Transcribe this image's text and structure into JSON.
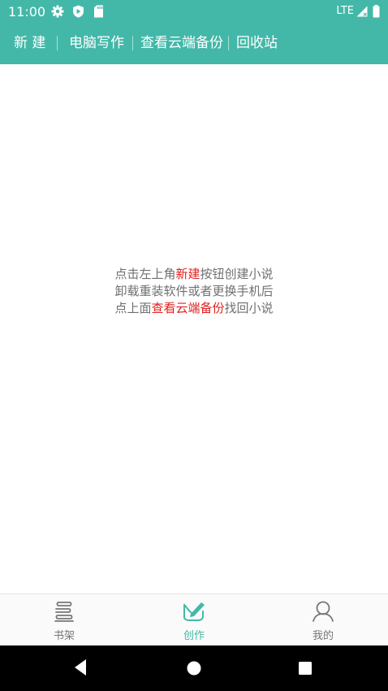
{
  "status_bar": {
    "time": "11:00",
    "network": "LTE",
    "icons": [
      "gear-icon",
      "play-protect-icon",
      "sd-card-icon",
      "signal-icon",
      "battery-icon"
    ]
  },
  "toolbar": {
    "items": [
      {
        "label": "新 建"
      },
      {
        "label": "电脑写作"
      },
      {
        "label": "查看云端备份"
      },
      {
        "label": "回收站"
      }
    ]
  },
  "hint": {
    "line1": {
      "pre": "点击左上角",
      "highlight": "新建",
      "post": "按钮创建小说"
    },
    "line2": "卸载重装软件或者更换手机后",
    "line3": {
      "pre": "点上面",
      "highlight": "查看云端备份",
      "post": "找回小说"
    }
  },
  "tab_bar": {
    "tabs": [
      {
        "label": "书架",
        "icon": "bookshelf-icon",
        "active": false
      },
      {
        "label": "创作",
        "icon": "write-icon",
        "active": true
      },
      {
        "label": "我的",
        "icon": "profile-icon",
        "active": false
      }
    ]
  },
  "nav_bar": {
    "icons": [
      "back-icon",
      "home-icon",
      "recents-icon"
    ]
  },
  "colors": {
    "accent": "#43b8a8",
    "highlight": "#e0201e",
    "hint_text": "#707070",
    "tab_inactive": "#777777"
  }
}
